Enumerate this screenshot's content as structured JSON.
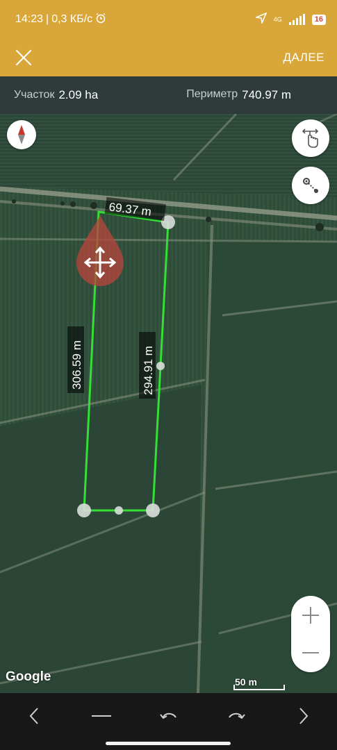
{
  "status_bar": {
    "time": "14:23",
    "speed": "0,3 КБ/с",
    "network": "4G",
    "battery": "16"
  },
  "app_bar": {
    "next_label": "ДАЛЕЕ"
  },
  "info_bar": {
    "area_label": "Участок",
    "area_value": "2.09 ha",
    "perimeter_label": "Периметр",
    "perimeter_value": "740.97 m"
  },
  "map": {
    "edges": {
      "top": "69.37 m",
      "left": "306.59 m",
      "right": "294.91 m"
    },
    "attribution": "Google",
    "scale_label": "50 m"
  },
  "colors": {
    "app_bar": "#d9a63a",
    "info_bar": "#2f3a3a",
    "polygon": "#34e034",
    "move_marker": "#b5453b",
    "nav_bar": "#181818"
  },
  "icons": {
    "close": "close-icon",
    "compass": "compass-icon",
    "touch_mode": "touch-mode-icon",
    "gps_measure": "gps-measure-icon",
    "move_marker": "move-icon",
    "zoom_in": "plus-icon",
    "zoom_out": "minus-icon"
  }
}
